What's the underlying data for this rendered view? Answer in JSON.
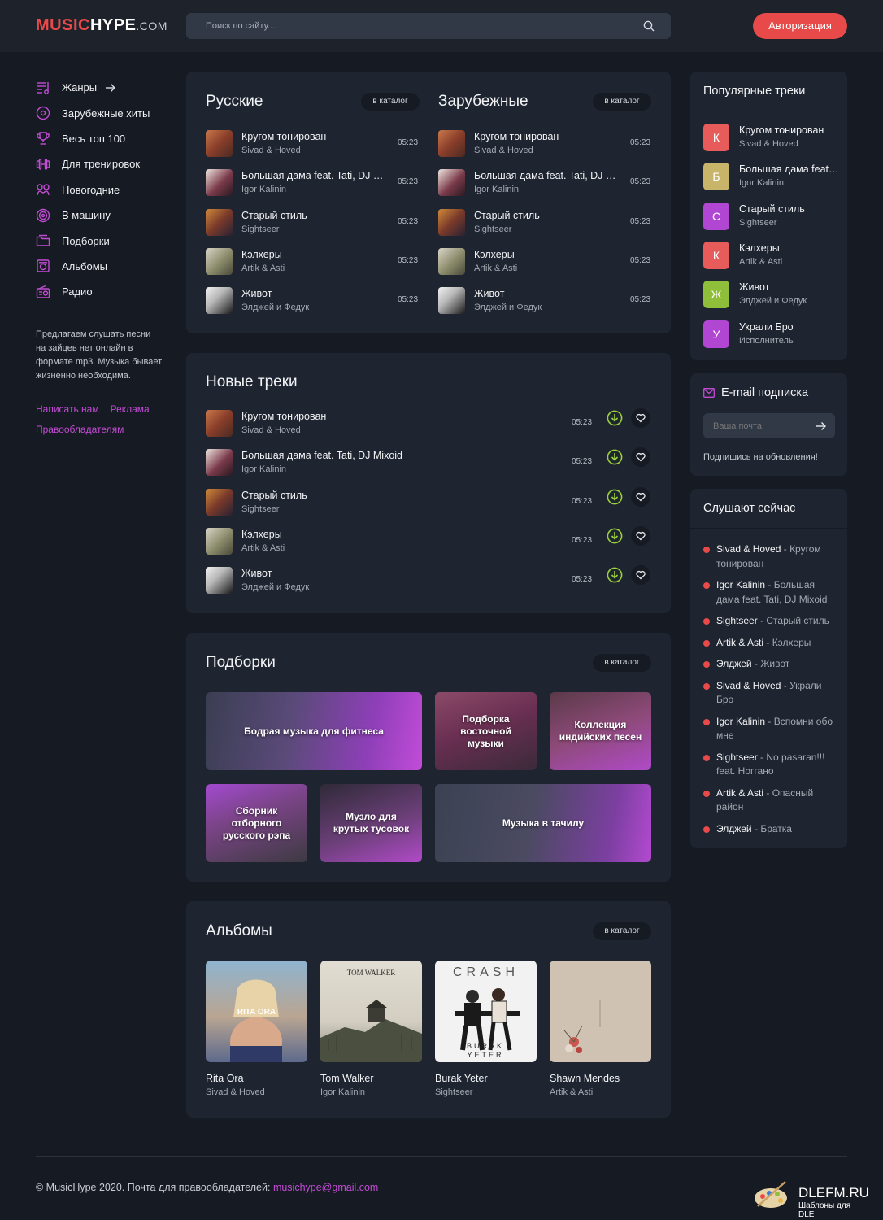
{
  "header": {
    "logo_music": "MUSIC",
    "logo_hype": "HYPE",
    "logo_com": ".COM",
    "search_placeholder": "Поиск по сайту...",
    "auth_label": "Авторизация"
  },
  "sidebar": {
    "items": [
      {
        "label": "Жанры",
        "icon": "genres-icon"
      },
      {
        "label": "Зарубежные хиты",
        "icon": "disc-icon"
      },
      {
        "label": "Весь топ 100",
        "icon": "trophy-icon"
      },
      {
        "label": "Для тренировок",
        "icon": "dumbbell-icon"
      },
      {
        "label": "Новогодние",
        "icon": "snowman-icon"
      },
      {
        "label": "В машину",
        "icon": "target-icon"
      },
      {
        "label": "Подборки",
        "icon": "folder-icon"
      },
      {
        "label": "Альбомы",
        "icon": "album-icon"
      },
      {
        "label": "Радио",
        "icon": "radio-icon"
      }
    ],
    "about": "Предлагаем слушать песни на зайцев нет онлайн в формате mp3. Музыка бывает жизненно необходима.",
    "link_write": "Написать нам",
    "link_ads": "Реклама",
    "link_rights": "Правообладателям"
  },
  "catalog_label": "в каталог",
  "russian": {
    "title": "Русские"
  },
  "foreign": {
    "title": "Зарубежные"
  },
  "tracks": [
    {
      "title": "Кругом тонирован",
      "artist": "Sivad & Hoved",
      "time": "05:23"
    },
    {
      "title": "Большая дама feat. Tati, DJ Mixoid",
      "artist": "Igor Kalinin",
      "time": "05:23"
    },
    {
      "title": "Старый стиль",
      "artist": "Sightseer",
      "time": "05:23"
    },
    {
      "title": "Кэлхеры",
      "artist": "Artik & Asti",
      "time": "05:23"
    },
    {
      "title": "Живот",
      "artist": "Элджей и Федук",
      "time": "05:23"
    }
  ],
  "new_tracks": {
    "title": "Новые треки"
  },
  "collections": {
    "title": "Подборки",
    "items": [
      "Бодрая музыка для фитнеса",
      "Подборка восточной музыки",
      "Коллекция индийских песен",
      "Сборник отборного русского рэпа",
      "Музло для крутых тусовок",
      "Музыка в тачилу"
    ]
  },
  "albums": {
    "title": "Альбомы",
    "items": [
      {
        "name": "Rita Ora",
        "artist": "Sivad & Hoved",
        "cover_text": "RITA ORA"
      },
      {
        "name": "Tom Walker",
        "artist": "Igor Kalinin",
        "cover_text": "TOM WALKER"
      },
      {
        "name": "Burak Yeter",
        "artist": "Sightseer",
        "cover_text": "CRASH"
      },
      {
        "name": "Shawn Mendes",
        "artist": "Artik & Asti",
        "cover_text": ""
      }
    ]
  },
  "popular": {
    "title": "Популярные треки",
    "items": [
      {
        "letter": "К",
        "title": "Кругом тонирован",
        "artist": "Sivad & Hoved",
        "color": "#e85b5b"
      },
      {
        "letter": "Б",
        "title": "Большая дама feat. Tati",
        "artist": "Igor Kalinin",
        "color": "#c9b56a"
      },
      {
        "letter": "С",
        "title": "Старый стиль",
        "artist": "Sightseer",
        "color": "#b146d3"
      },
      {
        "letter": "К",
        "title": "Кэлхеры",
        "artist": "Artik & Asti",
        "color": "#e85b5b"
      },
      {
        "letter": "Ж",
        "title": "Живот",
        "artist": "Элджей и Федук",
        "color": "#8fbf3a"
      },
      {
        "letter": "У",
        "title": "Украли Бро",
        "artist": "Исполнитель",
        "color": "#b146d3"
      }
    ]
  },
  "subscribe": {
    "title": "E-mail подписка",
    "placeholder": "Ваша почта",
    "note": "Подпишись на обновления!"
  },
  "listening": {
    "title": "Слушают сейчас",
    "items": [
      {
        "artist": "Sivad & Hoved",
        "track": "Кругом тонирован"
      },
      {
        "artist": "Igor Kalinin",
        "track": "Большая дама feat. Tati, DJ Mixoid"
      },
      {
        "artist": "Sightseer",
        "track": "Старый стиль"
      },
      {
        "artist": "Artik & Asti",
        "track": "Кэлхеры"
      },
      {
        "artist": "Элджей",
        "track": "Живот"
      },
      {
        "artist": "Sivad & Hoved",
        "track": "Украли Бро"
      },
      {
        "artist": "Igor Kalinin",
        "track": "Вспомни обо мне"
      },
      {
        "artist": "Sightseer",
        "track": "No pasaran!!! feat. Ноггано"
      },
      {
        "artist": "Artik & Asti",
        "track": "Опасный район"
      },
      {
        "artist": "Элджей",
        "track": "Братка"
      }
    ]
  },
  "footer": {
    "text": "© MusicHype 2020. Почта для правообладателей: ",
    "email": "musichype@gmail.com",
    "badge_title": "DLEFM.RU",
    "badge_sub": "Шаблоны для DLE"
  },
  "colors": {
    "accent_red": "#e84949",
    "accent_purple": "#c34bd6",
    "download_green": "#9bd13a",
    "card_bg": "#1f2530",
    "page_bg": "#161a22"
  }
}
